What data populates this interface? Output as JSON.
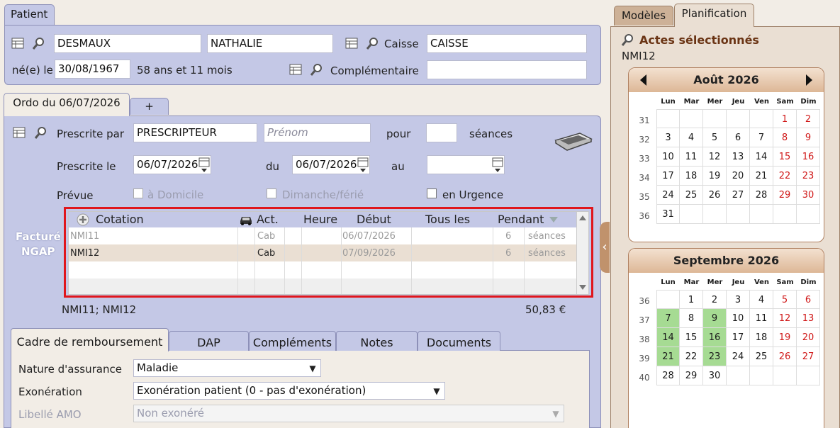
{
  "patient": {
    "tab": "Patient",
    "nom": "DESMAUX",
    "prenom": "NATHALIE",
    "caisse_label": "Caisse",
    "caisse": "CAISSE",
    "ne_le_label": "né(e) le",
    "date_naissance": "30/08/1967",
    "age": "58 ans et 11 mois",
    "complementaire_label": "Complémentaire",
    "complementaire": ""
  },
  "ordo": {
    "tab": "Ordo du 06/07/2026",
    "add_tab": "+",
    "prescrite_par_label": "Prescrite par",
    "prescripteur": "PRESCRIPTEUR",
    "prenom_placeholder": "Prénom",
    "pour_label": "pour",
    "pour_value": "",
    "seances_label": "séances",
    "prescrite_le_label": "Prescrite le",
    "prescrite_le": "06/07/2026",
    "du_label": "du",
    "du": "06/07/2026",
    "au_label": "au",
    "au": "",
    "prevue_label": "Prévue",
    "a_domicile": "à Domicile",
    "dimanche": "Dimanche/férié",
    "urgence": "en Urgence",
    "facture_label_1": "Facturé",
    "facture_label_2": "NGAP",
    "totals_codes": "NMI11; NMI12",
    "totals_amount": "50,83 €"
  },
  "grid": {
    "headers": {
      "cotation": "Cotation",
      "act": "Act.",
      "heure": "Heure",
      "debut": "Début",
      "tous_les": "Tous les",
      "pendant": "Pendant"
    },
    "rows": [
      {
        "cotation": "NMI11",
        "act": "Cab",
        "heure": "",
        "debut": "06/07/2026",
        "tous_les": "",
        "pendant": "6",
        "unit": "séances"
      },
      {
        "cotation": "NMI12",
        "act": "Cab",
        "heure": "",
        "debut": "07/09/2026",
        "tous_les": "",
        "pendant": "6",
        "unit": "séances"
      }
    ]
  },
  "bottom": {
    "tabs": [
      "Cadre de remboursement",
      "DAP",
      "Compléments",
      "Notes",
      "Documents"
    ],
    "nature_label": "Nature d'assurance",
    "nature": "Maladie",
    "exoneration_label": "Exonération",
    "exoneration": "Exonération patient (0 - pas d'exonération)",
    "libelle_label": "Libellé AMO",
    "libelle": "Non exonéré"
  },
  "right": {
    "tabs": [
      "Modèles",
      "Planification"
    ],
    "actes_title": "Actes sélectionnés",
    "actes_value": "NMI12"
  },
  "calendars": {
    "dow": [
      "Lun",
      "Mar",
      "Mer",
      "Jeu",
      "Ven",
      "Sam",
      "Dim"
    ],
    "aout": {
      "title": "Août 2026",
      "weeks": [
        "31",
        "32",
        "33",
        "34",
        "35",
        "36"
      ],
      "days": [
        [
          "",
          "",
          "",
          "",
          "",
          "1",
          "2"
        ],
        [
          "3",
          "4",
          "5",
          "6",
          "7",
          "8",
          "9"
        ],
        [
          "10",
          "11",
          "12",
          "13",
          "14",
          "15",
          "16"
        ],
        [
          "17",
          "18",
          "19",
          "20",
          "21",
          "22",
          "23"
        ],
        [
          "24",
          "25",
          "26",
          "27",
          "28",
          "29",
          "30"
        ],
        [
          "31",
          "",
          "",
          "",
          "",
          "",
          ""
        ]
      ]
    },
    "septembre": {
      "title": "Septembre 2026",
      "weeks": [
        "36",
        "37",
        "38",
        "39",
        "40"
      ],
      "days": [
        [
          "",
          "1",
          "2",
          "3",
          "4",
          "5",
          "6"
        ],
        [
          "7",
          "8",
          "9",
          "10",
          "11",
          "12",
          "13"
        ],
        [
          "14",
          "15",
          "16",
          "17",
          "18",
          "19",
          "20"
        ],
        [
          "21",
          "22",
          "23",
          "24",
          "25",
          "26",
          "27"
        ],
        [
          "28",
          "29",
          "30",
          "",
          "",
          "",
          ""
        ]
      ],
      "selected": [
        "7",
        "9",
        "14",
        "16",
        "21",
        "23"
      ]
    }
  },
  "colors": {
    "panel": "#c4c8e6",
    "highlight_border": "#e0161c",
    "selected_day": "#a6db93",
    "weekend": "#d01818"
  }
}
